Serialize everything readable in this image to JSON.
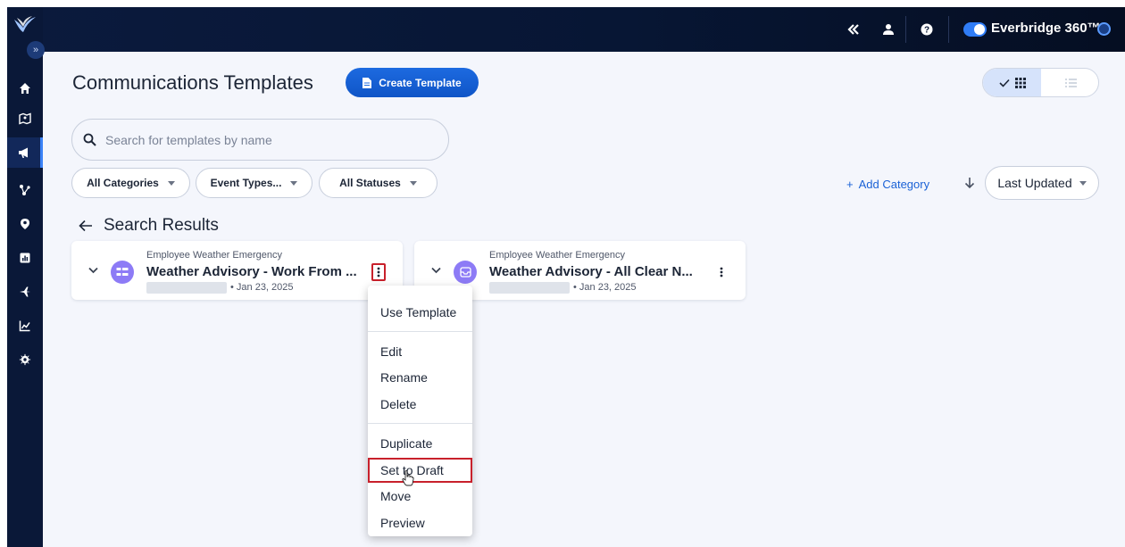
{
  "app": {
    "brand_name": "Everbridge 360™",
    "toggle_on": true
  },
  "topbar": {
    "icons": [
      "collapse-double-left-icon",
      "user-icon",
      "help-icon"
    ]
  },
  "sidebar": {
    "expand_glyph": "»",
    "items": [
      {
        "name": "home",
        "icon": "home-icon",
        "active": false
      },
      {
        "name": "map",
        "icon": "map-icon",
        "active": false
      },
      {
        "name": "communications",
        "icon": "megaphone-icon",
        "active": true
      },
      {
        "name": "incidents",
        "icon": "nodes-icon",
        "active": false
      },
      {
        "name": "locations",
        "icon": "location-pin-icon",
        "active": false
      },
      {
        "name": "reports",
        "icon": "bar-report-icon",
        "active": false
      },
      {
        "name": "travel",
        "icon": "plane-icon",
        "active": false
      },
      {
        "name": "analytics",
        "icon": "line-chart-icon",
        "active": false
      },
      {
        "name": "settings",
        "icon": "gear-icon",
        "active": false
      }
    ]
  },
  "header": {
    "title": "Communications Templates",
    "create_button": "Create Template"
  },
  "search": {
    "placeholder": "Search for templates by name",
    "value": ""
  },
  "filters": {
    "categories": "All Categories",
    "event_types": "Event Types...",
    "statuses": "All Statuses"
  },
  "actions": {
    "add_category": "Add Category",
    "sort_label": "Last Updated"
  },
  "results": {
    "heading": "Search Results",
    "cards": [
      {
        "category": "Employee Weather Emergency",
        "name": "Weather Advisory - Work From ...",
        "date": "• Jan 23, 2025"
      },
      {
        "category": "Employee Weather Emergency",
        "name": "Weather Advisory - All Clear N...",
        "date": "• Jan 23, 2025"
      }
    ]
  },
  "menu": {
    "use_template": "Use Template",
    "edit": "Edit",
    "rename": "Rename",
    "delete": "Delete",
    "duplicate": "Duplicate",
    "set_to_draft": "Set to Draft",
    "move": "Move",
    "preview": "Preview"
  },
  "colors": {
    "accent": "#1b62d6",
    "topbar": "#071634",
    "highlight": "#c8202b",
    "avatar": "#8d7bf6"
  }
}
